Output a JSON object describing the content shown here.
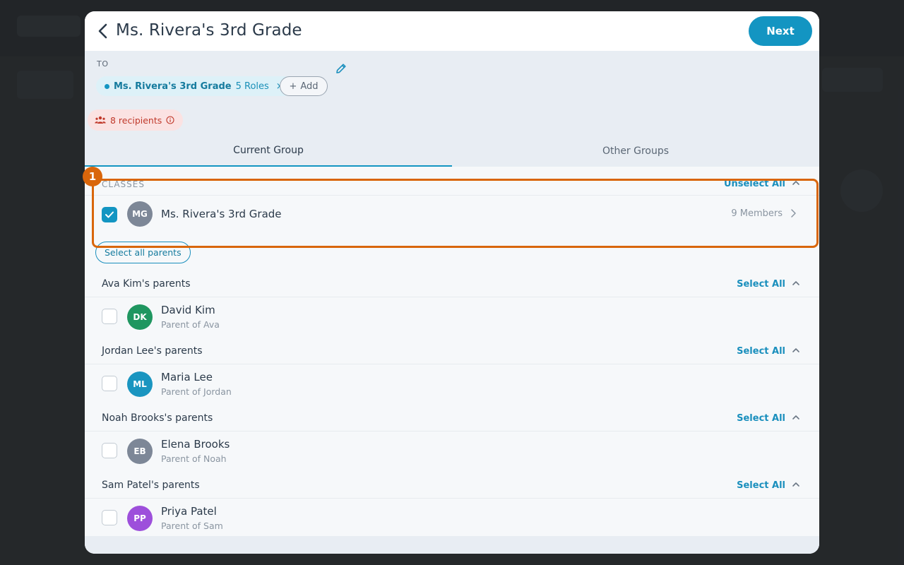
{
  "modal": {
    "title": "Ms. Rivera's 3rd Grade",
    "next_label": "Next"
  },
  "to": {
    "label": "TO",
    "chip": {
      "name": "Ms. Rivera's 3rd Grade",
      "roles": "5 Roles",
      "remove": "×"
    },
    "add_label": "Add",
    "recipients": "8 recipients"
  },
  "tabs": [
    {
      "label": "Current Group",
      "active": true
    },
    {
      "label": "Other Groups",
      "active": false
    }
  ],
  "classes": {
    "header": "CLASSES",
    "action": "Unselect All",
    "item": {
      "initials": "MG",
      "name": "Ms. Rivera's 3rd Grade",
      "members": "9 Members",
      "checked": true,
      "avatar_color": "#7d8797"
    }
  },
  "select_all_parents": "Select all parents",
  "parent_groups": [
    {
      "header": "Ava Kim's parents",
      "action": "Select All",
      "initials": "DK",
      "name": "David Kim",
      "sub": "Parent of Ava",
      "avatar_color": "#1f9660"
    },
    {
      "header": "Jordan Lee's parents",
      "action": "Select All",
      "initials": "ML",
      "name": "Maria Lee",
      "sub": "Parent of Jordan",
      "avatar_color": "#1a95c0"
    },
    {
      "header": "Noah Brooks's parents",
      "action": "Select All",
      "initials": "EB",
      "name": "Elena Brooks",
      "sub": "Parent of Noah",
      "avatar_color": "#7d8797"
    },
    {
      "header": "Sam Patel's parents",
      "action": "Select All",
      "initials": "PP",
      "name": "Priya Patel",
      "sub": "Parent of Sam",
      "avatar_color": "#9d4fdb"
    }
  ],
  "annotation": {
    "badge": "1",
    "color": "#d9660b"
  },
  "colors": {
    "accent": "#1395c2",
    "danger": "#c0392b"
  },
  "icons": [
    "back-arrow-icon",
    "pencil-icon",
    "plus-icon",
    "people-icon",
    "info-icon",
    "chevron-up-icon",
    "chevron-right-icon",
    "check-icon"
  ]
}
